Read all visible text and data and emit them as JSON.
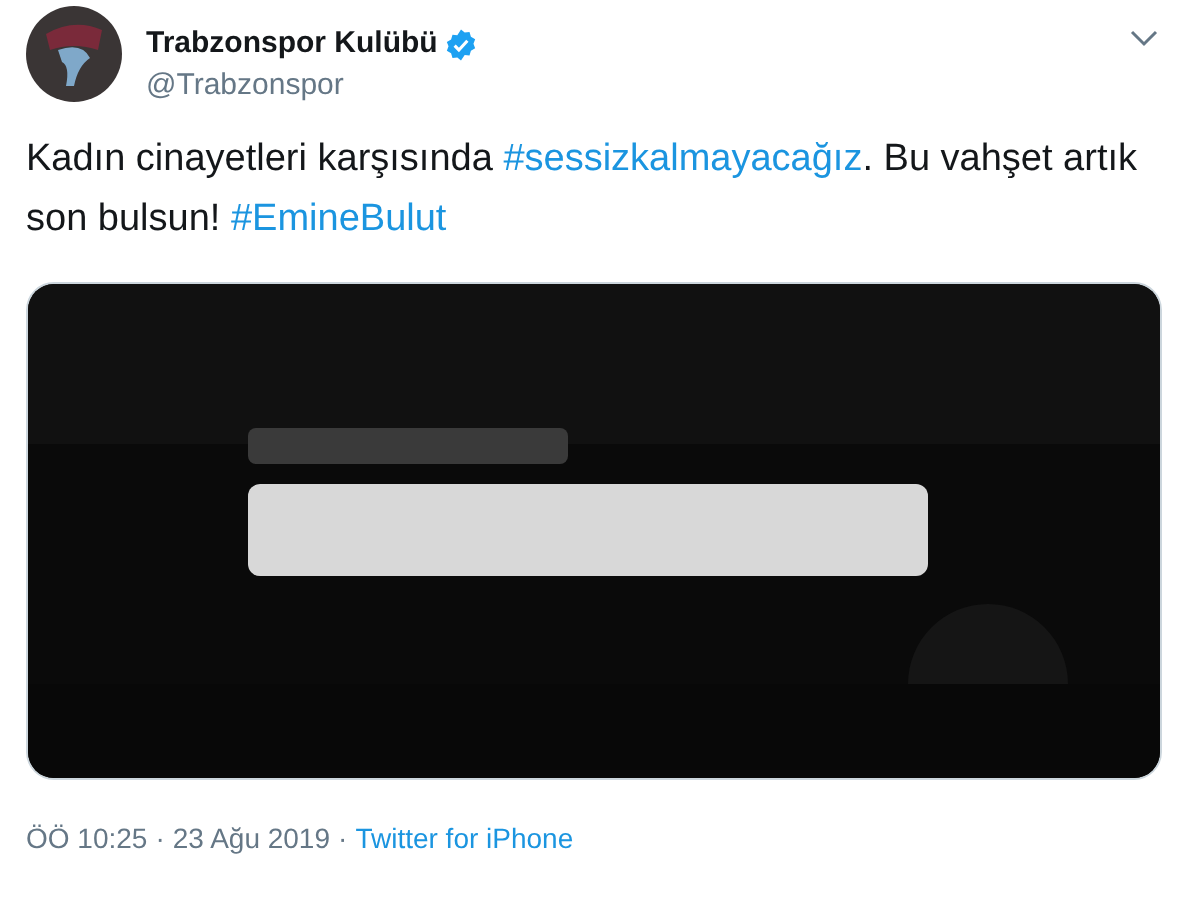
{
  "author": {
    "name": "Trabzonspor Kulübü",
    "verified": true,
    "handle": "@Trabzonspor"
  },
  "tweet": {
    "segments": [
      {
        "kind": "text",
        "text": "Kadın cinayetleri karşısında "
      },
      {
        "kind": "hashtag",
        "text": "#sessizkalmayacağız"
      },
      {
        "kind": "text",
        "text": ". Bu vahşet artık son bulsun! "
      },
      {
        "kind": "hashtag",
        "text": "#EmineBulut"
      }
    ]
  },
  "footer": {
    "time": "ÖÖ 10:25",
    "separator_1": "·",
    "date": "23 Ağu 2019",
    "separator_2": "·",
    "source": "Twitter for iPhone"
  }
}
